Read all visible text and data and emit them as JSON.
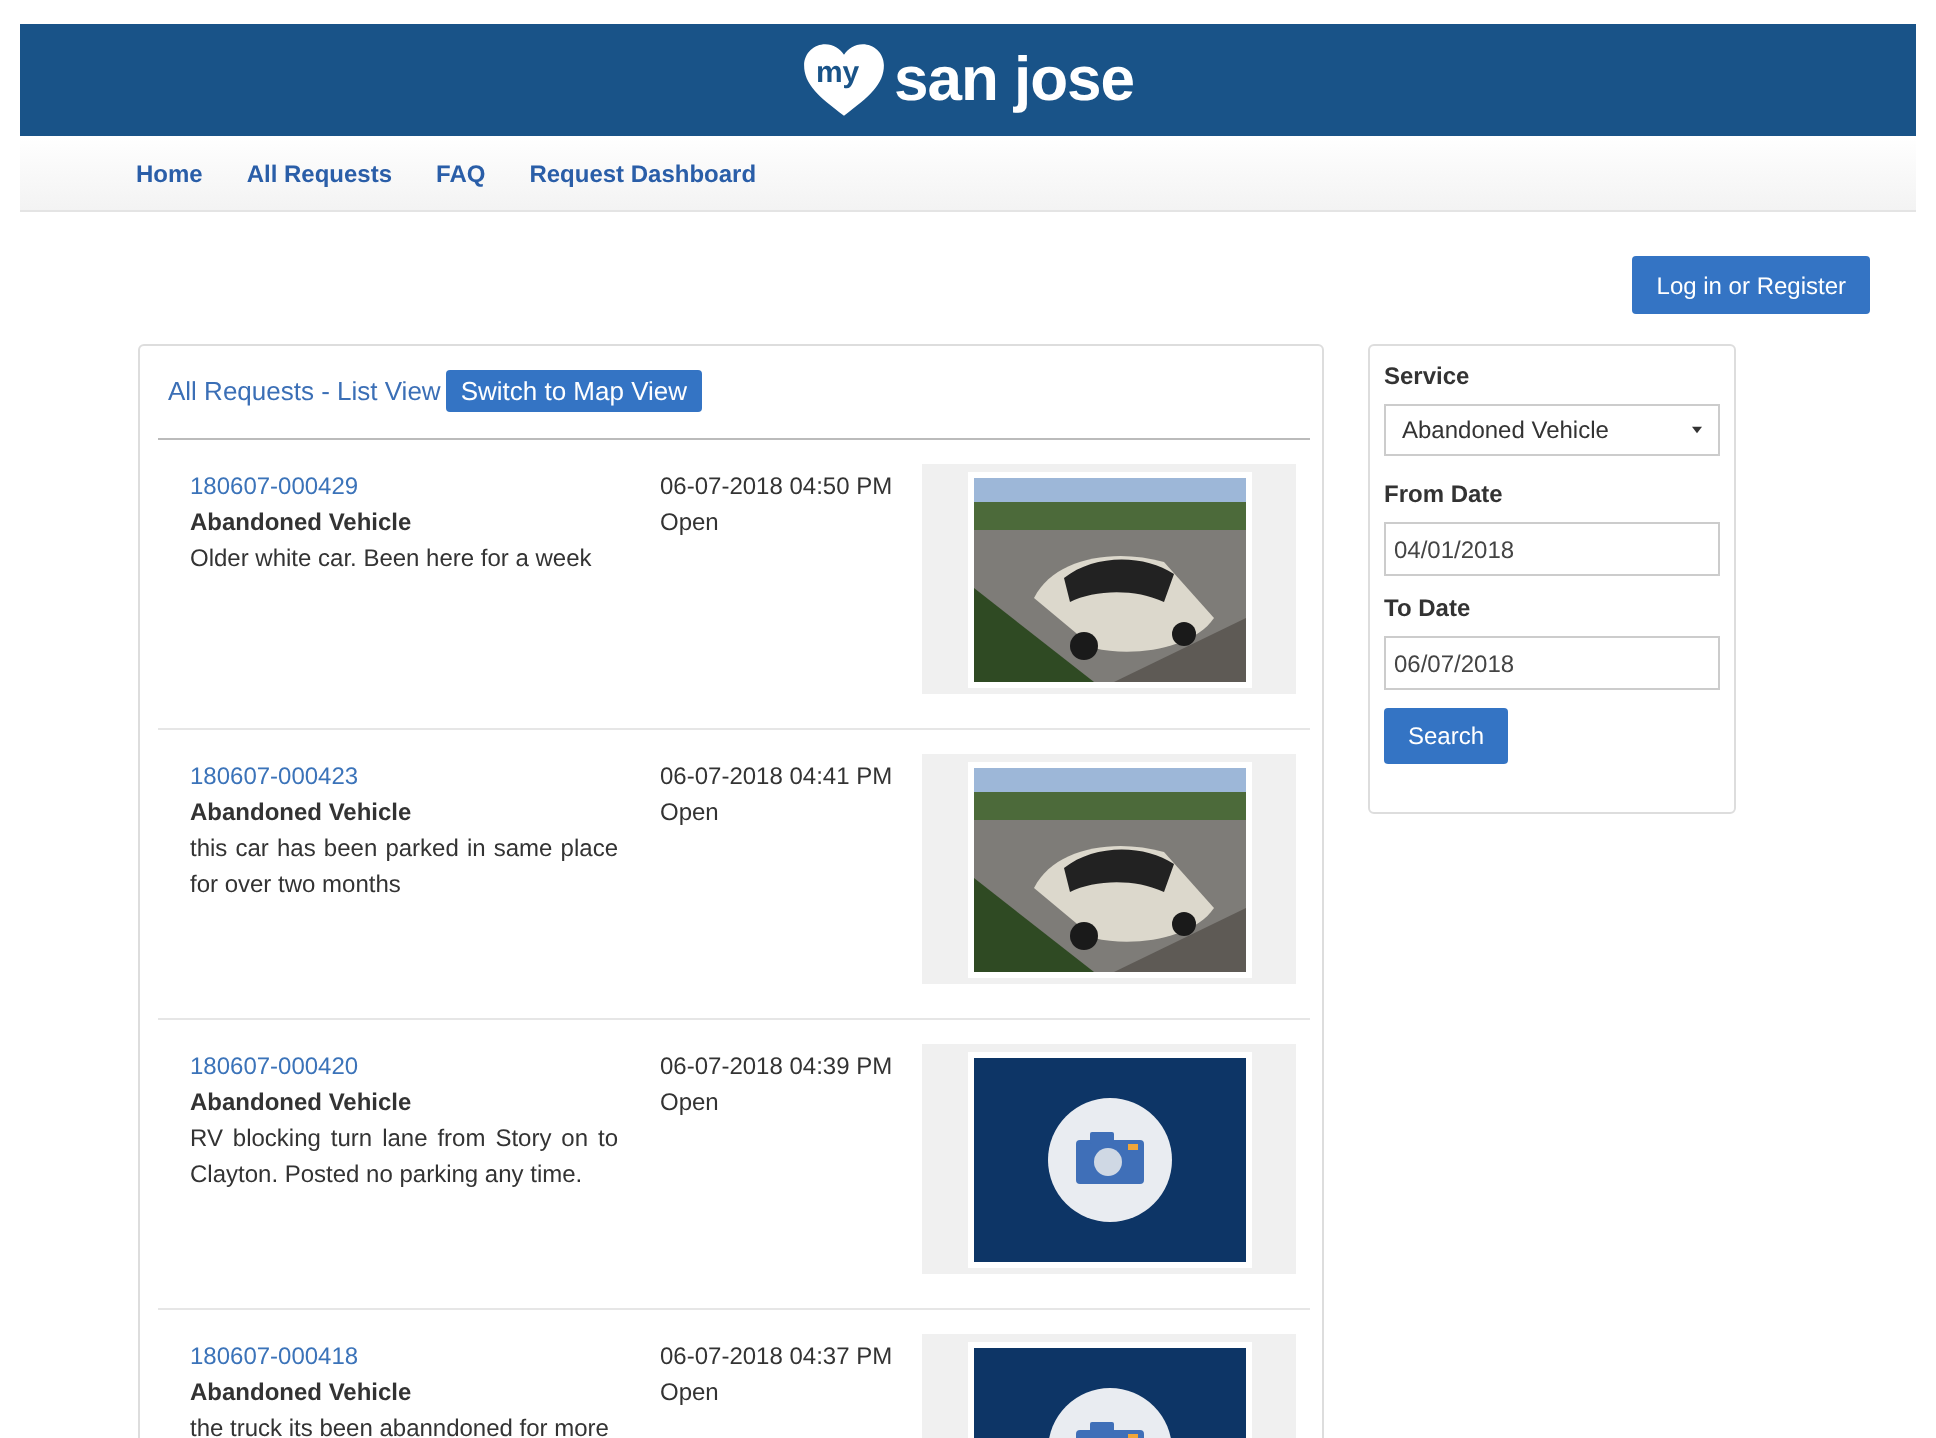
{
  "header": {
    "logo_badge": "my",
    "logo_text": "san jose"
  },
  "nav": [
    "Home",
    "All Requests",
    "FAQ",
    "Request Dashboard"
  ],
  "login_button": "Log in or Register",
  "list": {
    "title": "All Requests - List View",
    "map_button": "Switch to Map View",
    "requests": [
      {
        "id": "180607-000429",
        "service": "Abandoned Vehicle",
        "description": "Older white car. Been here for a week",
        "date": "06-07-2018 04:50 PM",
        "status": "Open"
      },
      {
        "id": "180607-000423",
        "service": "Abandoned Vehicle",
        "description": "this car has been parked in same place for over two months",
        "date": "06-07-2018 04:41 PM",
        "status": "Open"
      },
      {
        "id": "180607-000420",
        "service": "Abandoned Vehicle",
        "description": "RV blocking turn lane from Story on to Clayton. Posted no parking any time.",
        "date": "06-07-2018 04:39 PM",
        "status": "Open",
        "image": {
          "kind": "placeholder"
        }
      },
      {
        "id": "180607-000418",
        "service": "Abandoned Vehicle",
        "description": "the truck its been abanndoned for more",
        "date": "06-07-2018 04:37 PM",
        "status": "Open",
        "image": {
          "kind": "placeholder"
        }
      }
    ]
  },
  "filter": {
    "service_label": "Service",
    "service_value": "Abandoned Vehicle",
    "from_label": "From Date",
    "from_value": "04/01/2018",
    "to_label": "To Date",
    "to_value": "06/07/2018",
    "search_button": "Search"
  }
}
